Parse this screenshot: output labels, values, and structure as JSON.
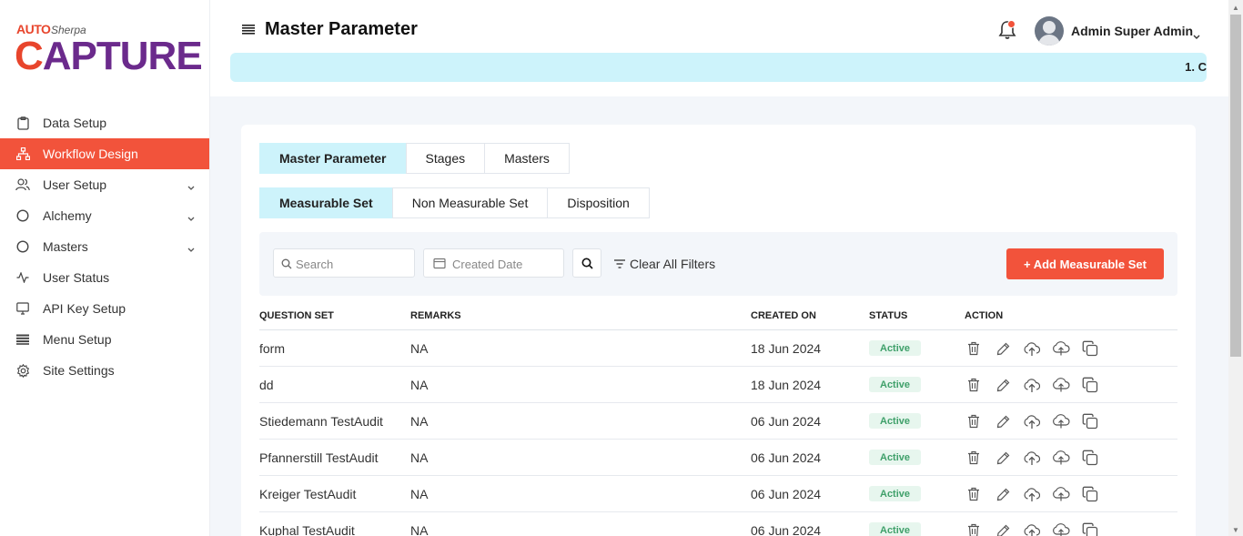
{
  "brand": {
    "auto": "AUTO",
    "sherpa": "Sherpa",
    "capture_c": "C",
    "capture_rest": "APTURE"
  },
  "sidebar": {
    "items": [
      {
        "label": "Data Setup",
        "icon": "clipboard-icon",
        "active": false,
        "expandable": false
      },
      {
        "label": "Workflow Design",
        "icon": "sitemap-icon",
        "active": true,
        "expandable": false
      },
      {
        "label": "User Setup",
        "icon": "users-icon",
        "active": false,
        "expandable": true
      },
      {
        "label": "Alchemy",
        "icon": "circle-icon",
        "active": false,
        "expandable": true
      },
      {
        "label": "Masters",
        "icon": "circle-icon",
        "active": false,
        "expandable": true
      },
      {
        "label": "User Status",
        "icon": "activity-icon",
        "active": false,
        "expandable": false
      },
      {
        "label": "API Key Setup",
        "icon": "monitor-icon",
        "active": false,
        "expandable": false
      },
      {
        "label": "Menu Setup",
        "icon": "list-icon",
        "active": false,
        "expandable": false
      },
      {
        "label": "Site Settings",
        "icon": "gear-icon",
        "active": false,
        "expandable": false
      }
    ]
  },
  "header": {
    "title": "Master Parameter",
    "user_name": "Admin Super Admin",
    "ticker_text": "1. C"
  },
  "tabs_primary": [
    {
      "label": "Master Parameter",
      "active": true
    },
    {
      "label": "Stages",
      "active": false
    },
    {
      "label": "Masters",
      "active": false
    }
  ],
  "tabs_secondary": [
    {
      "label": "Measurable Set",
      "active": true
    },
    {
      "label": "Non Measurable Set",
      "active": false
    },
    {
      "label": "Disposition",
      "active": false
    }
  ],
  "filters": {
    "search_placeholder": "Search",
    "date_placeholder": "Created Date",
    "clear_label": "Clear All Filters",
    "add_label": "+ Add Measurable Set"
  },
  "table": {
    "columns": [
      "QUESTION SET",
      "REMARKS",
      "CREATED ON",
      "STATUS",
      "ACTION"
    ],
    "rows": [
      {
        "question_set": "form",
        "remarks": "NA",
        "created_on": "18 Jun 2024",
        "status": "Active"
      },
      {
        "question_set": "dd",
        "remarks": "NA",
        "created_on": "18 Jun 2024",
        "status": "Active"
      },
      {
        "question_set": "Stiedemann TestAudit",
        "remarks": "NA",
        "created_on": "06 Jun 2024",
        "status": "Active"
      },
      {
        "question_set": "Pfannerstill TestAudit",
        "remarks": "NA",
        "created_on": "06 Jun 2024",
        "status": "Active"
      },
      {
        "question_set": "Kreiger TestAudit",
        "remarks": "NA",
        "created_on": "06 Jun 2024",
        "status": "Active"
      },
      {
        "question_set": "Kuphal TestAudit",
        "remarks": "NA",
        "created_on": "06 Jun 2024",
        "status": "Active"
      }
    ],
    "actions": [
      "delete-icon",
      "edit-icon",
      "upload-icon",
      "cloud-upload-icon",
      "copy-icon"
    ]
  },
  "colors": {
    "accent": "#f2533b",
    "tab_active": "#cdf3fb",
    "brand_purple": "#6b2a8c",
    "status_green": "#3fa06a"
  }
}
